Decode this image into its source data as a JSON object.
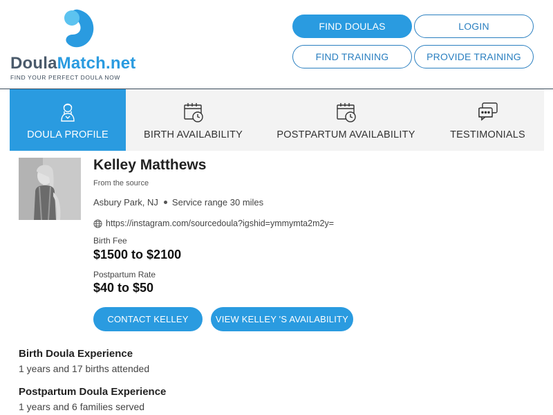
{
  "brand": {
    "name_part1": "Doula",
    "name_part2": "Match.net",
    "tagline": "FIND YOUR PERFECT DOULA NOW",
    "primary_color": "#2a9be0",
    "text_color": "#4a5a6b"
  },
  "nav": {
    "find_doulas": "FIND DOULAS",
    "login": "LOGIN",
    "find_training": "FIND TRAINING",
    "provide_training": "PROVIDE TRAINING"
  },
  "tabs": [
    {
      "label": "DOULA PROFILE",
      "icon": "doula-person-icon",
      "active": true
    },
    {
      "label": "BIRTH AVAILABILITY",
      "icon": "calendar-clock-icon",
      "active": false
    },
    {
      "label": "POSTPARTUM AVAILABILITY",
      "icon": "calendar-clock-icon",
      "active": false
    },
    {
      "label": "TESTIMONIALS",
      "icon": "chat-bubbles-icon",
      "active": false
    }
  ],
  "profile": {
    "name": "Kelley Matthews",
    "subtitle": "From the source",
    "location": "Asbury Park, NJ",
    "service_range": "Service range 30 miles",
    "website": "https://instagram.com/sourcedoula?igshid=ymmymta2m2y=",
    "birth_fee_label": "Birth Fee",
    "birth_fee": "$1500 to $2100",
    "postpartum_rate_label": "Postpartum Rate",
    "postpartum_rate": "$40 to $50",
    "contact_button": "CONTACT KELLEY",
    "availability_button": "VIEW KELLEY 'S AVAILABILITY"
  },
  "experience": {
    "birth_title": "Birth Doula Experience",
    "birth_text": "1 years and 17 births attended",
    "postpartum_title": "Postpartum Doula Experience",
    "postpartum_text": "1 years and 6 families served"
  }
}
